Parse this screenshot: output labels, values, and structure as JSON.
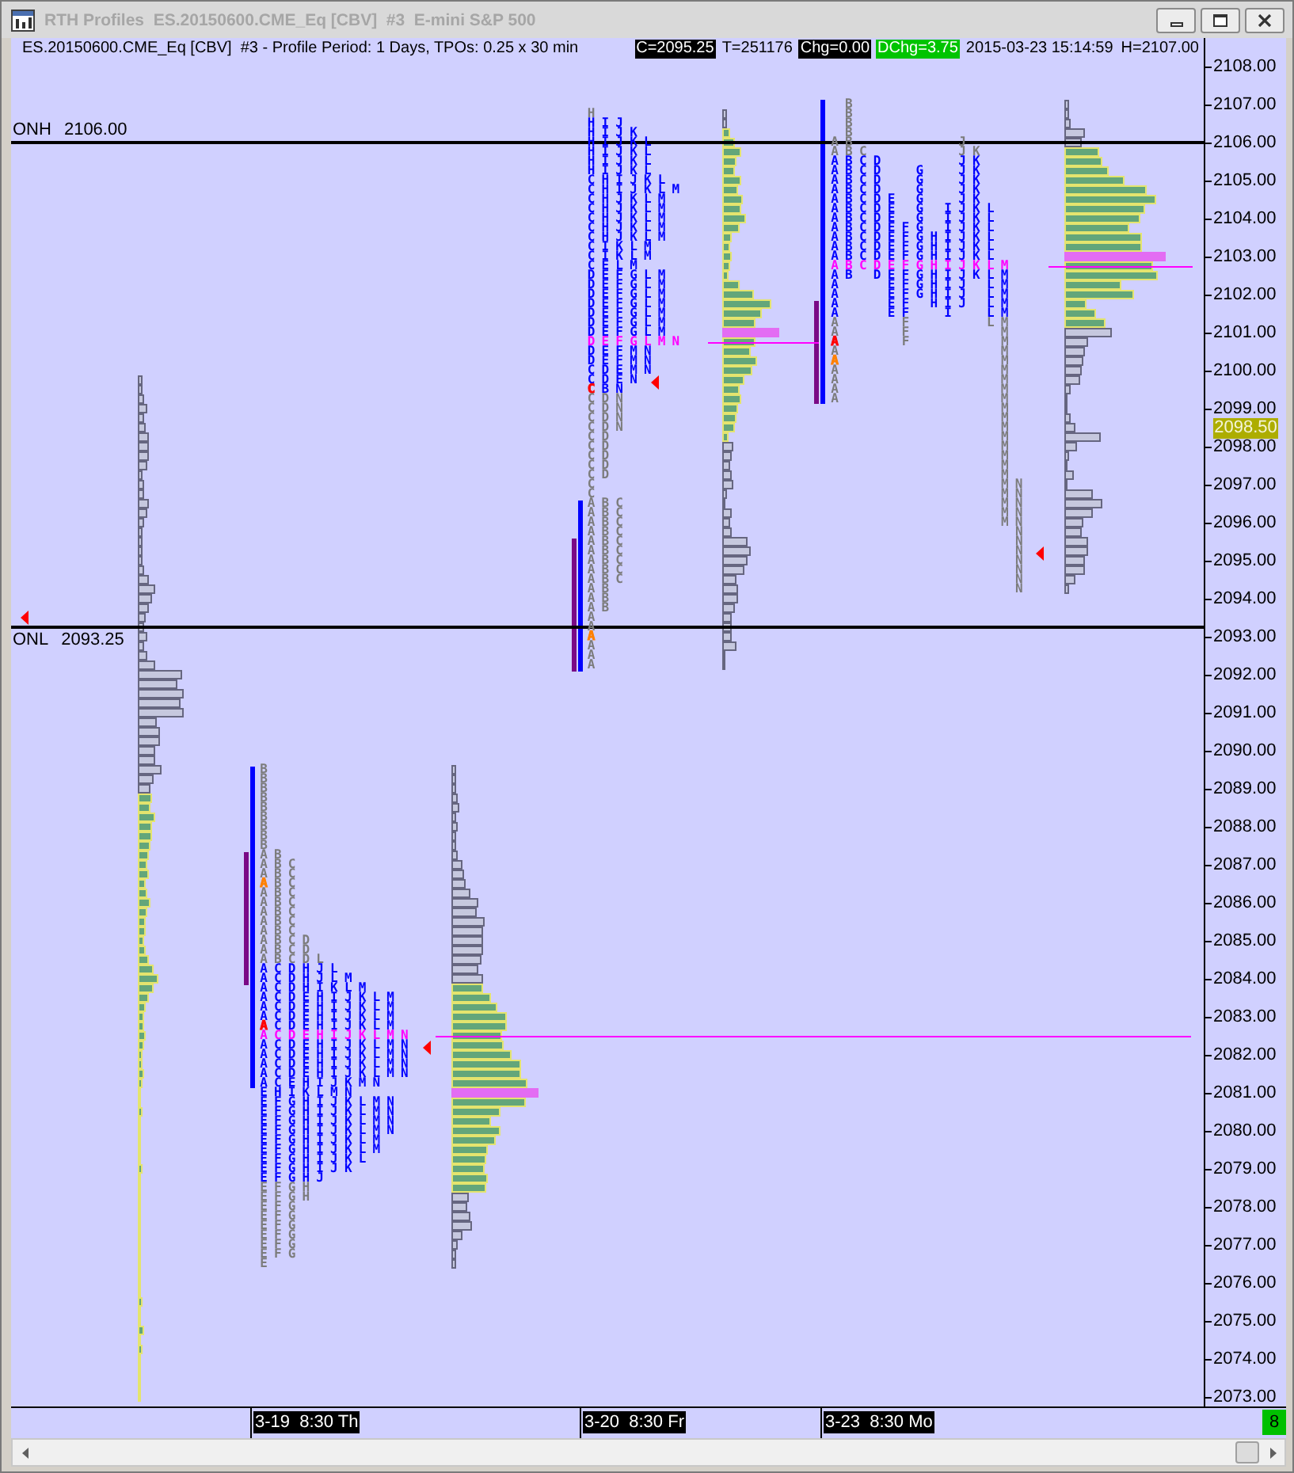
{
  "window": {
    "title": "RTH Profiles  ES.20150600.CME_Eq [CBV]  #3  E-mini S&P 500",
    "active": false
  },
  "header": {
    "description": "ES.20150600.CME_Eq [CBV]  #3 - Profile Period: 1 Days, TPOs: 0.25 x 30 min",
    "fields": [
      {
        "text": "C=2095.25",
        "kind": "inverse"
      },
      {
        "text": "T=251176",
        "kind": "plain"
      },
      {
        "text": "Chg=0.00",
        "kind": "inverse"
      },
      {
        "text": "DChg=3.75",
        "kind": "positive"
      },
      {
        "text": "2015-03-23 15:14:59",
        "kind": "plain"
      },
      {
        "text": "H=2107.00",
        "kind": "plain"
      }
    ]
  },
  "reference_lines": [
    {
      "label": "ONH",
      "value": "2106.00"
    },
    {
      "label": "ONL",
      "value": "2093.25"
    }
  ],
  "profiles": [
    {
      "rows": [
        {
          "letters": "B",
          "value_area": false,
          "poc": false
        },
        {
          "letters": "B",
          "value_area": false,
          "poc": false
        },
        {
          "letters": "B",
          "value_area": false,
          "poc": false
        },
        {
          "letters": "B",
          "value_area": false,
          "poc": false
        },
        {
          "letters": "B",
          "value_area": false,
          "poc": false
        },
        {
          "letters": "B",
          "value_area": false,
          "poc": false
        },
        {
          "letters": "B",
          "value_area": false,
          "poc": false
        },
        {
          "letters": "B",
          "value_area": false,
          "poc": false
        },
        {
          "letters": "B",
          "value_area": false,
          "poc": false
        },
        {
          "letters": "AB",
          "value_area": false,
          "poc": false
        },
        {
          "letters": "ABC",
          "value_area": false,
          "poc": false
        },
        {
          "letters": "ABC",
          "value_area": false,
          "poc": false
        },
        {
          "letters": "ABC",
          "value_area": false,
          "poc": false,
          "color": "#ff8000"
        },
        {
          "letters": "ABC",
          "value_area": false,
          "poc": false
        },
        {
          "letters": "ABC",
          "value_area": false,
          "poc": false
        },
        {
          "letters": "ABC",
          "value_area": false,
          "poc": false
        },
        {
          "letters": "ABC",
          "value_area": false,
          "poc": false
        },
        {
          "letters": "ABC",
          "value_area": false,
          "poc": false
        },
        {
          "letters": "ABCD",
          "value_area": false,
          "poc": false
        },
        {
          "letters": "ABCD",
          "value_area": false,
          "poc": false
        },
        {
          "letters": "ABCDL",
          "value_area": false,
          "poc": false
        },
        {
          "letters": "ACDHJL",
          "value_area": true,
          "poc": false
        },
        {
          "letters": "ACDHJLM",
          "value_area": true,
          "poc": false
        },
        {
          "letters": "ACDHIKLM",
          "value_area": true,
          "poc": false
        },
        {
          "letters": "ACDEHIJKLM",
          "value_area": true,
          "poc": false
        },
        {
          "letters": "ACDEHIJKLM",
          "value_area": true,
          "poc": false
        },
        {
          "letters": "ACDEHIJKLM",
          "value_area": true,
          "poc": false
        },
        {
          "letters": "ACDEHIJKLM",
          "value_area": true,
          "poc": false,
          "color": "#ff0000"
        },
        {
          "letters": "ACDEHIJKLMN",
          "value_area": true,
          "poc": true
        },
        {
          "letters": "ACDEHIJKLMN",
          "value_area": true,
          "poc": false
        },
        {
          "letters": "ACDEHIJKLMN",
          "value_area": true,
          "poc": false
        },
        {
          "letters": "ACDEHIJKLMN",
          "value_area": true,
          "poc": false
        },
        {
          "letters": "ACDEHIJKLMN",
          "value_area": true,
          "poc": false
        },
        {
          "letters": "ACEHIJKMN",
          "value_area": true,
          "poc": false
        },
        {
          "letters": "EHIKLMN",
          "value_area": true,
          "poc": false
        },
        {
          "letters": "EFGHIJKLMN",
          "value_area": true,
          "poc": false
        },
        {
          "letters": "EFGHIJKLMN",
          "value_area": true,
          "poc": false
        },
        {
          "letters": "EFGHIJKLMN",
          "value_area": true,
          "poc": false
        },
        {
          "letters": "EFGHIJKLMN",
          "value_area": true,
          "poc": false
        },
        {
          "letters": "EFGHIJKLM",
          "value_area": true,
          "poc": false
        },
        {
          "letters": "EFGHIJKLM",
          "value_area": true,
          "poc": false
        },
        {
          "letters": "EFGHIJKL",
          "value_area": true,
          "poc": false
        },
        {
          "letters": "EFGHIJK",
          "value_area": true,
          "poc": false
        },
        {
          "letters": "EFGHJ",
          "value_area": true,
          "poc": false
        },
        {
          "letters": "EFGH",
          "value_area": false,
          "poc": false
        },
        {
          "letters": "EFGH",
          "value_area": false,
          "poc": false
        },
        {
          "letters": "EFG",
          "value_area": false,
          "poc": false
        },
        {
          "letters": "EFG",
          "value_area": false,
          "poc": false
        },
        {
          "letters": "EFG",
          "value_area": false,
          "poc": false
        },
        {
          "letters": "EFG",
          "value_area": false,
          "poc": false
        },
        {
          "letters": "EFG",
          "value_area": false,
          "poc": false
        },
        {
          "letters": "EFG",
          "value_area": false,
          "poc": false
        },
        {
          "letters": "E",
          "value_area": false,
          "poc": false
        }
      ]
    },
    {
      "rows": [
        {
          "letters": "H",
          "value_area": false,
          "poc": false
        },
        {
          "letters": "HIJ",
          "value_area": true,
          "poc": false
        },
        {
          "letters": "HIJK",
          "value_area": true,
          "poc": false
        },
        {
          "letters": "HIJKL",
          "value_area": true,
          "poc": false
        },
        {
          "letters": "HIJKL",
          "value_area": true,
          "poc": false
        },
        {
          "letters": "HIJKL",
          "value_area": true,
          "poc": false
        },
        {
          "letters": "HIJKL",
          "value_area": true,
          "poc": false
        },
        {
          "letters": "CHIJKL",
          "value_area": true,
          "poc": false
        },
        {
          "letters": "CHIJKLM",
          "value_area": true,
          "poc": false
        },
        {
          "letters": "CHJKLM",
          "value_area": true,
          "poc": false
        },
        {
          "letters": "CHJKLM",
          "value_area": true,
          "poc": false
        },
        {
          "letters": "CHJKLM",
          "value_area": true,
          "poc": false
        },
        {
          "letters": "CHJKLM",
          "value_area": true,
          "poc": false
        },
        {
          "letters": "CHJKLM",
          "value_area": true,
          "poc": false
        },
        {
          "letters": "CIKLM",
          "value_area": true,
          "poc": false
        },
        {
          "letters": "CIKLM",
          "value_area": true,
          "poc": false
        },
        {
          "letters": "CELM",
          "value_area": true,
          "poc": false
        },
        {
          "letters": "DEFGLM",
          "value_area": true,
          "poc": false
        },
        {
          "letters": "DEFGLM",
          "value_area": true,
          "poc": false
        },
        {
          "letters": "DEFGLM",
          "value_area": true,
          "poc": false
        },
        {
          "letters": "DEFGLM",
          "value_area": true,
          "poc": false
        },
        {
          "letters": "DEFGLM",
          "value_area": true,
          "poc": false
        },
        {
          "letters": "DEFGLM",
          "value_area": true,
          "poc": false
        },
        {
          "letters": "DEFGLM",
          "value_area": true,
          "poc": false
        },
        {
          "letters": "DEFGLMN",
          "value_area": true,
          "poc": true
        },
        {
          "letters": "DEFMN",
          "value_area": true,
          "poc": false
        },
        {
          "letters": "DEFMN",
          "value_area": true,
          "poc": false
        },
        {
          "letters": "CDEMN",
          "value_area": true,
          "poc": false
        },
        {
          "letters": "CDEN",
          "value_area": true,
          "poc": false
        },
        {
          "letters": "CBN",
          "value_area": true,
          "poc": false,
          "color": "#ff0000"
        },
        {
          "letters": "CDN",
          "value_area": false,
          "poc": false
        },
        {
          "letters": "CDN",
          "value_area": false,
          "poc": false
        },
        {
          "letters": "CDN",
          "value_area": false,
          "poc": false
        },
        {
          "letters": "CDN",
          "value_area": false,
          "poc": false
        },
        {
          "letters": "CD",
          "value_area": false,
          "poc": false
        },
        {
          "letters": "CD",
          "value_area": false,
          "poc": false
        },
        {
          "letters": "CD",
          "value_area": false,
          "poc": false
        },
        {
          "letters": "CD",
          "value_area": false,
          "poc": false
        },
        {
          "letters": "CD",
          "value_area": false,
          "poc": false
        },
        {
          "letters": "C",
          "value_area": false,
          "poc": false
        },
        {
          "letters": "C",
          "value_area": false,
          "poc": false
        },
        {
          "letters": "ABC",
          "value_area": false,
          "poc": false
        },
        {
          "letters": "ABC",
          "value_area": false,
          "poc": false
        },
        {
          "letters": "ABC",
          "value_area": false,
          "poc": false
        },
        {
          "letters": "ABC",
          "value_area": false,
          "poc": false
        },
        {
          "letters": "ABC",
          "value_area": false,
          "poc": false
        },
        {
          "letters": "ABC",
          "value_area": false,
          "poc": false
        },
        {
          "letters": "ABC",
          "value_area": false,
          "poc": false
        },
        {
          "letters": "ABC",
          "value_area": false,
          "poc": false
        },
        {
          "letters": "ABC",
          "value_area": false,
          "poc": false
        },
        {
          "letters": "AB",
          "value_area": false,
          "poc": false
        },
        {
          "letters": "AB",
          "value_area": false,
          "poc": false
        },
        {
          "letters": "AB",
          "value_area": false,
          "poc": false
        },
        {
          "letters": "A",
          "value_area": false,
          "poc": false
        },
        {
          "letters": "A",
          "value_area": false,
          "poc": false
        },
        {
          "letters": "A",
          "value_area": false,
          "poc": false,
          "color": "#ff8000"
        },
        {
          "letters": "A",
          "value_area": false,
          "poc": false
        },
        {
          "letters": "A",
          "value_area": false,
          "poc": false
        },
        {
          "letters": "A",
          "value_area": false,
          "poc": false
        }
      ]
    },
    {
      "rows": [
        {
          "letters": "B",
          "value_area": false,
          "poc": false
        },
        {
          "letters": "B",
          "value_area": false,
          "poc": false
        },
        {
          "letters": "B",
          "value_area": false,
          "poc": false
        },
        {
          "letters": "B",
          "value_area": false,
          "poc": false
        },
        {
          "letters": "AB       J",
          "value_area": false,
          "poc": false
        },
        {
          "letters": "ABC      JK",
          "value_area": false,
          "poc": false
        },
        {
          "letters": "ABCD     JK",
          "value_area": true,
          "poc": false
        },
        {
          "letters": "ABCD  G  JK",
          "value_area": true,
          "poc": false
        },
        {
          "letters": "ABCD  G  JK",
          "value_area": true,
          "poc": false
        },
        {
          "letters": "ABCD  G  JK",
          "value_area": true,
          "poc": false
        },
        {
          "letters": "ABCDE G  JK",
          "value_area": true,
          "poc": false
        },
        {
          "letters": "ABCDE G IJKL",
          "value_area": true,
          "poc": false
        },
        {
          "letters": "ABCDE G IJKL",
          "value_area": true,
          "poc": false
        },
        {
          "letters": "ABCDEFG IJKL",
          "value_area": true,
          "poc": false
        },
        {
          "letters": "ABCDEFGHIJKL",
          "value_area": true,
          "poc": false
        },
        {
          "letters": "ABCDEFGHIJKL",
          "value_area": true,
          "poc": false
        },
        {
          "letters": "ABCDEFGHIJKL",
          "value_area": true,
          "poc": false
        },
        {
          "letters": "ABCDEFGHIJKLM",
          "value_area": true,
          "poc": true
        },
        {
          "letters": "AB DEFGHIJKLM",
          "value_area": true,
          "poc": false
        },
        {
          "letters": "A   EFGHIJ LM",
          "value_area": true,
          "poc": false
        },
        {
          "letters": "A   EFGHIJ LM",
          "value_area": true,
          "poc": false
        },
        {
          "letters": "A   EF HIJ LM",
          "value_area": true,
          "poc": false
        },
        {
          "letters": "A   EF  I  LM",
          "value_area": true,
          "poc": false
        },
        {
          "letters": "A    F     LM",
          "value_area": false,
          "poc": false
        },
        {
          "letters": "A    F      M",
          "value_area": false,
          "poc": false
        },
        {
          "letters": "A    F      M",
          "value_area": false,
          "poc": false,
          "color": "#ff0000"
        },
        {
          "letters": "A           M",
          "value_area": false,
          "poc": false
        },
        {
          "letters": "A           M",
          "value_area": false,
          "poc": false,
          "color": "#ff8000"
        },
        {
          "letters": "A           M",
          "value_area": false,
          "poc": false
        },
        {
          "letters": "A           M",
          "value_area": false,
          "poc": false
        },
        {
          "letters": "A           M",
          "value_area": false,
          "poc": false
        },
        {
          "letters": "A           M",
          "value_area": false,
          "poc": false
        },
        {
          "letters": "M",
          "value_area": false,
          "poc": false
        },
        {
          "letters": "M",
          "value_area": false,
          "poc": false
        },
        {
          "letters": "M",
          "value_area": false,
          "poc": false
        },
        {
          "letters": "M",
          "value_area": false,
          "poc": false
        },
        {
          "letters": "M",
          "value_area": false,
          "poc": false
        },
        {
          "letters": "M",
          "value_area": false,
          "poc": false
        },
        {
          "letters": "M",
          "value_area": false,
          "poc": false
        },
        {
          "letters": "M",
          "value_area": false,
          "poc": false
        },
        {
          "letters": "MN",
          "value_area": false,
          "poc": false
        },
        {
          "letters": "MN",
          "value_area": false,
          "poc": false
        },
        {
          "letters": "MN",
          "value_area": false,
          "poc": false
        },
        {
          "letters": "MN",
          "value_area": false,
          "poc": false
        },
        {
          "letters": "MN",
          "value_area": false,
          "poc": false
        },
        {
          "letters": "N",
          "value_area": false,
          "poc": false
        },
        {
          "letters": "N",
          "value_area": false,
          "poc": false
        },
        {
          "letters": "N",
          "value_area": false,
          "poc": false
        },
        {
          "letters": "N",
          "value_area": false,
          "poc": false
        },
        {
          "letters": "N",
          "value_area": false,
          "poc": false
        },
        {
          "letters": "N",
          "value_area": false,
          "poc": false
        },
        {
          "letters": "N",
          "value_area": false,
          "poc": false
        }
      ]
    }
  ],
  "price_axis": {
    "labels": [
      "2108.00",
      "2107.00",
      "2106.00",
      "2105.00",
      "2104.00",
      "2103.00",
      "2102.00",
      "2101.00",
      "2100.00",
      "2099.00",
      "2098.00",
      "2097.00",
      "2096.00",
      "2095.00",
      "2094.00",
      "2093.00",
      "2092.00",
      "2091.00",
      "2090.00",
      "2089.00",
      "2088.00",
      "2087.00",
      "2086.00",
      "2085.00",
      "2084.00",
      "2083.00",
      "2082.00",
      "2081.00",
      "2080.00",
      "2079.00",
      "2078.00",
      "2077.00",
      "2076.00",
      "2075.00",
      "2074.00",
      "2073.00"
    ],
    "last_price": "2098.50"
  },
  "time_axis": {
    "labels": [
      "3-19  8:30 Th",
      "3-20  8:30 Fr",
      "3-23  8:30 Mo"
    ],
    "badge": "8"
  }
}
